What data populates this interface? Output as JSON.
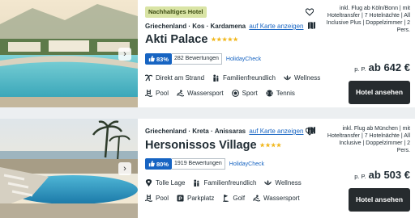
{
  "colors": {
    "link": "#1764c2",
    "rating_badge": "#1764c2",
    "stars": "#f1b71c",
    "badge_bg": "#d9e4a5",
    "button_bg": "#262b2e",
    "card_bg": "#ffffff",
    "page_bg": "#eceff1"
  },
  "hotels": [
    {
      "badge": "Nachhaltiges Hotel",
      "location": {
        "country": "Griechenland",
        "sep1": "·",
        "region": "Kos",
        "sep2": "·",
        "city": "Kardamena"
      },
      "map_link": "auf Karte anzeigen",
      "name": "Akti Palace",
      "stars": "★★★★★",
      "rating": {
        "percent": "83%",
        "reviews": "282 Bewertungen",
        "source": "HolidayCheck"
      },
      "features": [
        [
          "Direkt am Strand",
          "Familienfreundlich",
          "Wellness"
        ],
        [
          "Pool",
          "Wassersport",
          "Sport",
          "Tennis"
        ]
      ],
      "feature_icons": [
        [
          "beach-icon",
          "family-icon",
          "wellness-icon"
        ],
        [
          "pool-icon",
          "watersport-icon",
          "sport-icon",
          "tennis-icon"
        ]
      ],
      "offer": "inkl. Flug ab Köln/Bonn | mit Hoteltransfer | 7 Hotelnächte | All Inclusive Plus | Doppelzimmer | 2 Pers.",
      "price_prefix": "p. P.",
      "price": "ab 642 €",
      "button": "Hotel ansehen"
    },
    {
      "location": {
        "country": "Griechenland",
        "sep1": "·",
        "region": "Kreta",
        "sep2": "·",
        "city": "Anissaras"
      },
      "map_link": "auf Karte anzeigen",
      "name": "Hersonissos Village",
      "stars": "★★★★",
      "rating": {
        "percent": "80%",
        "reviews": "1919 Bewertungen",
        "source": "HolidayCheck"
      },
      "features": [
        [
          "Tolle Lage",
          "Familienfreundlich",
          "Wellness"
        ],
        [
          "Pool",
          "Parkplatz",
          "Golf",
          "Wassersport"
        ]
      ],
      "feature_icons": [
        [
          "location-pin-icon",
          "family-icon",
          "wellness-icon"
        ],
        [
          "pool-icon",
          "parking-icon",
          "golf-icon",
          "watersport-icon"
        ]
      ],
      "offer": "inkl. Flug ab München | mit Hoteltransfer | 7 Hotelnächte | All Inclusive | Doppelzimmer | 2 Pers.",
      "price_prefix": "p. P.",
      "price": "ab 503 €",
      "button": "Hotel ansehen"
    }
  ]
}
